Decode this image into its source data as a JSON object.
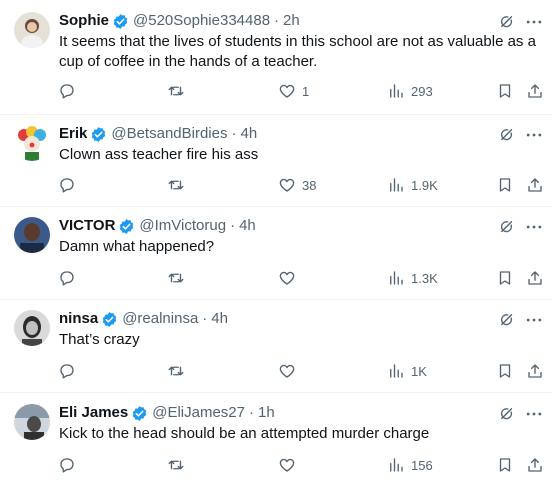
{
  "colors": {
    "verified": "#1d9bf0",
    "text": "#0f1419",
    "muted": "#536471",
    "divider": "#eff3f4"
  },
  "tweets": [
    {
      "name": "Sophie",
      "handle": "@520Sophie334488",
      "time": "2h",
      "text": "It seems that the lives of students in this school are not as valuable as a cup of coffee in the hands of a teacher.",
      "likes": "1",
      "views": "293",
      "avatar_icon": "avatar-sophie"
    },
    {
      "name": "Erik",
      "handle": "@BetsandBirdies",
      "time": "4h",
      "text": "Clown ass teacher fire his ass",
      "likes": "38",
      "views": "1.9K",
      "avatar_icon": "avatar-clown"
    },
    {
      "name": "VICTOR",
      "handle": "@ImVictorug",
      "time": "4h",
      "text": "Damn what happened?",
      "likes": "",
      "views": "1.3K",
      "avatar_icon": "avatar-victor"
    },
    {
      "name": "ninsa",
      "handle": "@realninsa",
      "time": "4h",
      "text": "That’s crazy",
      "likes": "",
      "views": "1K",
      "avatar_icon": "avatar-ninsa"
    },
    {
      "name": "Eli James",
      "handle": "@EliJames27",
      "time": "1h",
      "text": "Kick to the head should be an attempted murder charge",
      "likes": "",
      "views": "156",
      "avatar_icon": "avatar-eli"
    }
  ],
  "separator": "·"
}
